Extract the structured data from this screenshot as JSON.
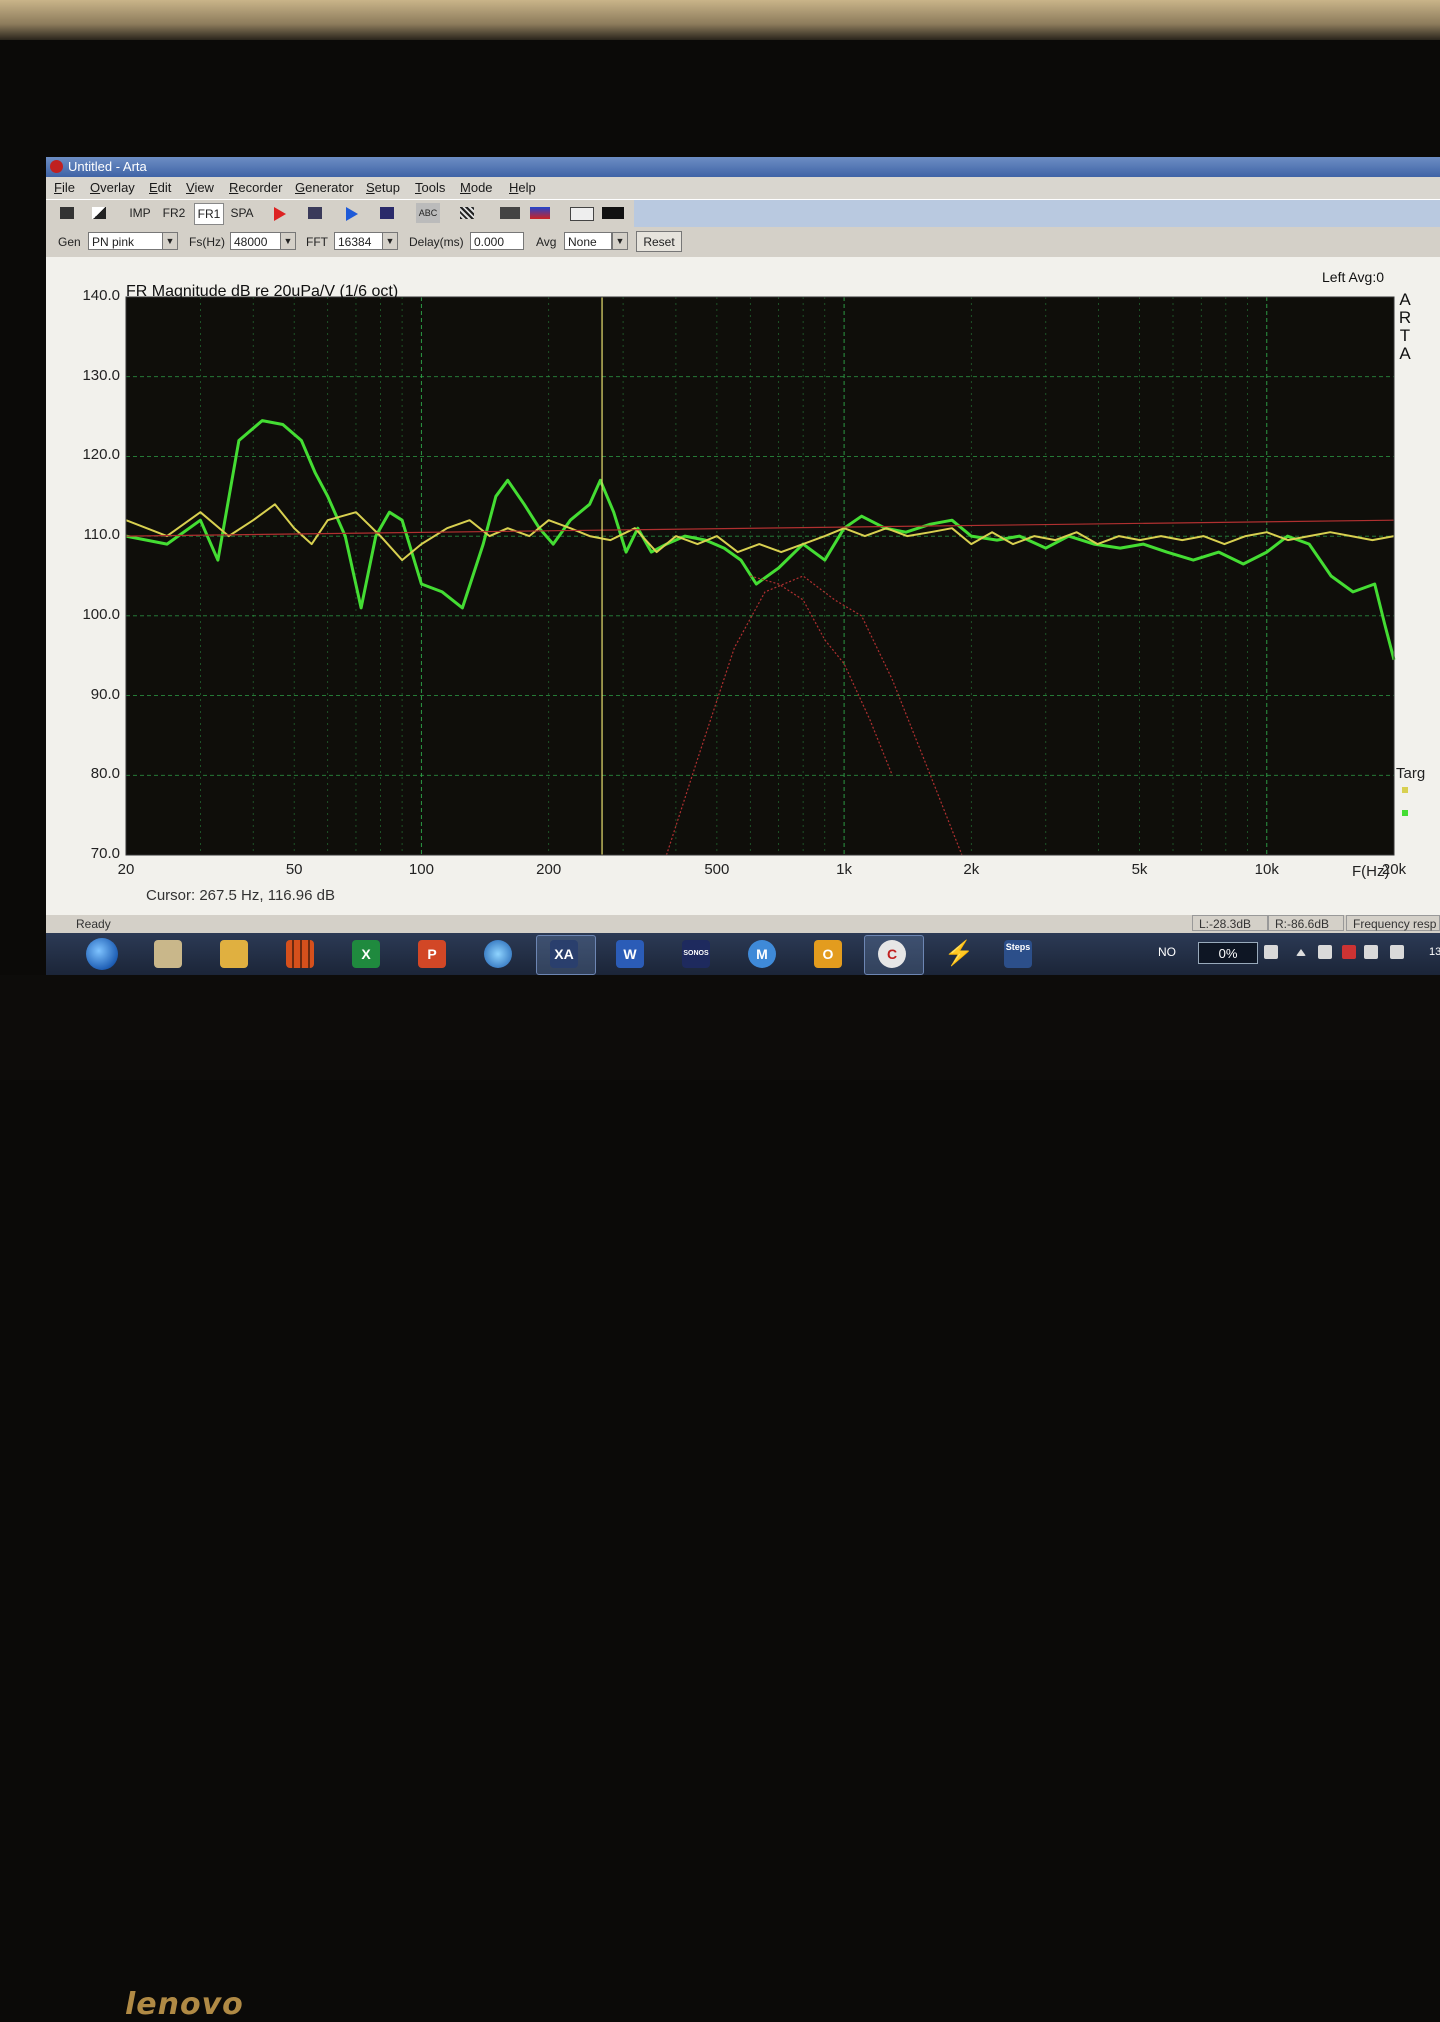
{
  "device": {
    "brand": "lenovo"
  },
  "window": {
    "title": "Untitled - Arta",
    "minimize_glyph": "—"
  },
  "menu": [
    "File",
    "Overlay",
    "Edit",
    "View",
    "Recorder",
    "Generator",
    "Setup",
    "Tools",
    "Mode",
    "Help"
  ],
  "toolbar": {
    "imp": "IMP",
    "fr2": "FR2",
    "fr1": "FR1",
    "spa": "SPA",
    "abc": "ABC"
  },
  "generator_bar": {
    "gen_label": "Gen",
    "gen_value": "PN pink",
    "fs_label": "Fs(Hz)",
    "fs_value": "48000",
    "fft_label": "FFT",
    "fft_value": "16384",
    "delay_label": "Delay(ms)",
    "delay_value": "0.000",
    "avg_label": "Avg",
    "avg_value": "None",
    "reset_label": "Reset"
  },
  "graph": {
    "title": "FR Magnitude dB re 20uPa/V (1/6 oct)",
    "channel_avg": "Left  Avg:0",
    "vertical_brand": "ARTA",
    "x_unit": "F(Hz)",
    "cursor_readout": "Cursor:   267.5 Hz, 116.96 dB",
    "legend_first": "Targ"
  },
  "status": {
    "ready": "Ready",
    "left_level": "L:-28.3dB",
    "right_level": "R:-86.6dB",
    "mode": "Frequency resp"
  },
  "tray": {
    "language": "NO",
    "battery_percent": "0%",
    "clock": "13"
  },
  "taskbar_apps": [
    {
      "icon": "start-orb"
    },
    {
      "icon": "file-manager-icon"
    },
    {
      "icon": "media-player-icon"
    },
    {
      "icon": "grid-app-icon"
    },
    {
      "icon": "excel-icon",
      "label": "X"
    },
    {
      "icon": "powerpoint-icon",
      "label": "P"
    },
    {
      "icon": "windows-media-icon"
    },
    {
      "icon": "xa-app-icon",
      "label": "XA"
    },
    {
      "icon": "word-icon",
      "label": "W"
    },
    {
      "icon": "sonos-icon",
      "label": "SONOS"
    },
    {
      "icon": "m-app-icon",
      "label": "M"
    },
    {
      "icon": "outlook-icon",
      "label": "O"
    },
    {
      "icon": "arta-icon",
      "label": "C"
    },
    {
      "icon": "bolt-icon"
    },
    {
      "icon": "steps-icon",
      "label": "Steps"
    }
  ],
  "colors": {
    "plot_bg": "#0f0e0a",
    "grid": "#2fa84a",
    "trace_measured": "#44dd33",
    "trace_reference": "#d8d050",
    "trace_target": "#b03030",
    "cursor": "#e8e070"
  },
  "chart_data": {
    "type": "line",
    "title": "FR Magnitude dB re 20uPa/V (1/6 oct)",
    "xlabel": "F(Hz)",
    "ylabel": "",
    "x_scale": "log",
    "xlim": [
      20,
      20000
    ],
    "ylim": [
      70,
      140
    ],
    "x_ticks": [
      "20",
      "50",
      "100",
      "200",
      "500",
      "1k",
      "2k",
      "5k",
      "10k",
      "20k"
    ],
    "y_ticks": [
      "140.0",
      "130.0",
      "120.0",
      "110.0",
      "100.0",
      "90.0",
      "80.0",
      "70.0"
    ],
    "grid": true,
    "cursor": {
      "x": 267.5,
      "y": 116.96
    },
    "series": [
      {
        "name": "",
        "color": "#44dd33",
        "x": [
          20,
          25,
          30,
          33,
          37,
          42,
          47,
          52,
          56,
          60,
          66,
          72,
          78,
          84,
          90,
          100,
          112,
          125,
          140,
          150,
          160,
          175,
          190,
          205,
          225,
          250,
          265,
          285,
          305,
          325,
          350,
          380,
          420,
          470,
          520,
          570,
          620,
          700,
          800,
          900,
          1000,
          1100,
          1250,
          1400,
          1600,
          1800,
          2000,
          2300,
          2600,
          3000,
          3400,
          3900,
          4500,
          5100,
          5800,
          6700,
          7700,
          8800,
          10000,
          11200,
          12600,
          14200,
          16000,
          18000,
          19000,
          20000
        ],
        "y": [
          110,
          109,
          112,
          107,
          122,
          124.5,
          124,
          122,
          118,
          115,
          110,
          101,
          110,
          113,
          112,
          104,
          103,
          101,
          109,
          115,
          117,
          114,
          111,
          109,
          112,
          114,
          117,
          113,
          108,
          111,
          108,
          109,
          110,
          109.5,
          108.5,
          107,
          104,
          106,
          109,
          107,
          111,
          112.5,
          111,
          110.5,
          111.5,
          112,
          110,
          109.5,
          110,
          108.5,
          110,
          109,
          108.5,
          109,
          108,
          107,
          108,
          106.5,
          108,
          110,
          109,
          105,
          103,
          104,
          99,
          94.5
        ]
      },
      {
        "name": "",
        "color": "#d8d050",
        "x": [
          20,
          25,
          30,
          35,
          40,
          45,
          50,
          55,
          60,
          70,
          80,
          90,
          100,
          115,
          130,
          145,
          160,
          180,
          200,
          225,
          250,
          280,
          320,
          360,
          400,
          450,
          500,
          560,
          630,
          710,
          800,
          900,
          1000,
          1120,
          1260,
          1410,
          1600,
          1800,
          2000,
          2240,
          2510,
          2820,
          3160,
          3550,
          3980,
          4470,
          5010,
          5620,
          6310,
          7080,
          7940,
          8910,
          10000,
          11220,
          12590,
          14130,
          15850,
          17780,
          20000
        ],
        "y": [
          112,
          110,
          113,
          110,
          112,
          114,
          111,
          109,
          112,
          113,
          110,
          107,
          109,
          111,
          112,
          110,
          111,
          110,
          112,
          111,
          110,
          109.5,
          111,
          108,
          110,
          109,
          110,
          108,
          109,
          108,
          109,
          110,
          111,
          110,
          111,
          110,
          110.5,
          111,
          109,
          110.5,
          109,
          110,
          109.5,
          110.5,
          109,
          110,
          109.5,
          110,
          109.5,
          110,
          109,
          110,
          110.5,
          109.5,
          110,
          110.5,
          110,
          109.5,
          110
        ]
      },
      {
        "name": "Targ",
        "color": "#b03030",
        "x": [
          20,
          20000
        ],
        "y": [
          110,
          112
        ]
      },
      {
        "name": "",
        "color": "#b03030",
        "style": "dotted",
        "x": [
          380,
          450,
          550,
          650,
          800,
          950,
          1100,
          1300,
          1600,
          1900
        ],
        "y": [
          70,
          82,
          96,
          103,
          105,
          102,
          100,
          92,
          80,
          70
        ]
      },
      {
        "name": "",
        "color": "#b03030",
        "style": "dotted",
        "x": [
          600,
          700,
          800,
          900,
          1000,
          1150,
          1300
        ],
        "y": [
          105,
          104,
          102,
          97,
          94,
          87,
          80
        ]
      }
    ]
  }
}
